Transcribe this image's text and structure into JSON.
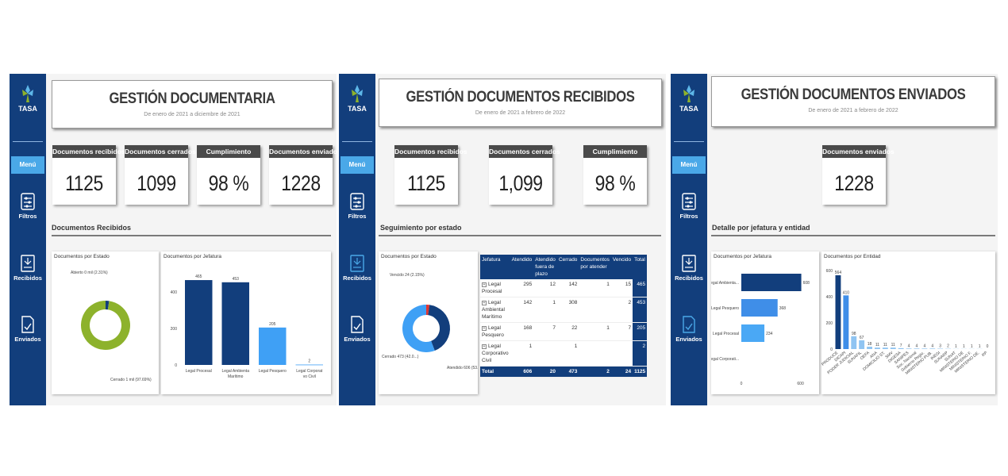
{
  "brand": {
    "logo_text": "TASA",
    "accent": "#123e7c",
    "highlight": "#4aa8e8"
  },
  "nav": {
    "menu": "Menú",
    "filtros": "Filtros",
    "recibidos": "Recibidos",
    "enviados": "Enviados"
  },
  "dash1": {
    "title": "GESTIÓN DOCUMENTARIA",
    "subtitle": "De enero de 2021 a diciembre de 2021",
    "kpis": [
      {
        "label": "Documentos recibidos",
        "value": "1125"
      },
      {
        "label": "Documentos cerrados",
        "value": "1099"
      },
      {
        "label": "Cumplimiento",
        "value": "98 %"
      },
      {
        "label": "Documentos enviados",
        "value": "1228"
      }
    ],
    "section": "Documentos Recibidos",
    "donut_card": "Documentos por Estado",
    "bar_card": "Documentos por Jefatura"
  },
  "dash2": {
    "title": "GESTIÓN DOCUMENTOS RECIBIDOS",
    "subtitle": "De enero de 2021 a febrero de 2022",
    "kpis": [
      {
        "label": "Documentos recibidos",
        "value": "1125"
      },
      {
        "label": "Documentos cerrados",
        "value": "1,099"
      },
      {
        "label": "Cumplimiento",
        "value": "98 %"
      }
    ],
    "section": "Seguimiento por estado",
    "donut_card": "Documentos por Estado",
    "table": {
      "headers": [
        "Jefatura",
        "Atendido",
        "Atendido fuera de plazo",
        "Cerrado",
        "Documentos por atender",
        "Vencido",
        "Total"
      ],
      "rows": [
        [
          "Legal Procesal",
          "295",
          "12",
          "142",
          "1",
          "15",
          "465"
        ],
        [
          "Legal Ambiental Marítimo",
          "142",
          "1",
          "308",
          "",
          "2",
          "453"
        ],
        [
          "Legal Pesquero",
          "168",
          "7",
          "22",
          "1",
          "7",
          "205"
        ],
        [
          "Legal Corporativo Civil",
          "1",
          "",
          "1",
          "",
          "",
          "2"
        ]
      ],
      "total": [
        "Total",
        "606",
        "20",
        "473",
        "2",
        "24",
        "1125"
      ]
    }
  },
  "dash3": {
    "title": "GESTIÓN DOCUMENTOS ENVIADOS",
    "subtitle": "De enero de 2021 a febrero de 2022",
    "kpi": {
      "label": "Documentos enviados",
      "value": "1228"
    },
    "section": "Detalle por jefatura y entidad",
    "hbar_card": "Documentos por Jefatura",
    "vbar_card": "Documentos por Entidad"
  },
  "chart_data": [
    {
      "type": "pie",
      "title": "Documentos por Estado",
      "categories": [
        "Abierto",
        "Cerrado"
      ],
      "values": [
        0.0231,
        0.9769
      ],
      "labels": [
        "Abierto 0 mil (2.31%)",
        "Cerrado 1 mil (97.69%)"
      ],
      "colors": [
        "#123e7c",
        "#8db22c"
      ]
    },
    {
      "type": "bar",
      "title": "Documentos por Jefatura",
      "categories": [
        "Legal Procesal",
        "Legal Ambiental Marítimo",
        "Legal Pesquero",
        "Legal Corporativo Civil"
      ],
      "values": [
        465,
        453,
        205,
        2
      ],
      "yticks": [
        "400",
        "200",
        "0"
      ],
      "ylim": [
        0,
        500
      ],
      "colors": [
        "#123e7c",
        "#123e7c",
        "#3fa0f5",
        "#3fa0f5"
      ]
    },
    {
      "type": "pie",
      "title": "Documentos por Estado",
      "categories": [
        "Vencido",
        "Cerrado",
        "Atendido"
      ],
      "values": [
        0.0216,
        0.42,
        0.5584
      ],
      "labels": [
        "Vencido 24 (2.15%)",
        "Cerrado 473 (42.0...)",
        "Atendido 606 (53.87%)"
      ],
      "colors": [
        "#e0342f",
        "#123e7c",
        "#3fa0f5"
      ]
    },
    {
      "type": "bar",
      "orientation": "horizontal",
      "title": "Documentos por Jefatura",
      "categories": [
        "Legal Ambienta...",
        "Legal Pesquero",
        "Legal Procesal",
        "Legal Corporati..."
      ],
      "values": [
        608,
        368,
        234,
        0
      ],
      "xticks": [
        "0",
        "600"
      ],
      "xlim": [
        0,
        700
      ],
      "colors": [
        "#123e7c",
        "#3f8ee8",
        "#4aa8f5",
        "#4aa8f5"
      ]
    },
    {
      "type": "bar",
      "title": "Documentos por Entidad",
      "categories": [
        "PRODUCE",
        "DICAPI",
        "PODER JUDICIAL",
        "SUNAFIL",
        "OEFA",
        "ANA",
        "DOMICILIO ST.",
        "SMV",
        "DIGESA",
        "SANIPES",
        "Soc. Nacional",
        "Gobierno Regio.",
        "MINISTERIO PUB.",
        "INEGI",
        "SUNARP",
        "SUNAT",
        "MINISTERIO DE",
        "MINISTERIO F.",
        "MINISTERIO DE.",
        "RP"
      ],
      "values": [
        564,
        410,
        98,
        67,
        18,
        11,
        11,
        11,
        7,
        4,
        4,
        4,
        4,
        3,
        2,
        1,
        1,
        1,
        1,
        0
      ],
      "yticks": [
        "600",
        "400",
        "200",
        "0"
      ],
      "ylim": [
        0,
        600
      ],
      "colors": [
        "#123e7c",
        "#3f8ee8",
        "#8fc4f2"
      ]
    }
  ]
}
